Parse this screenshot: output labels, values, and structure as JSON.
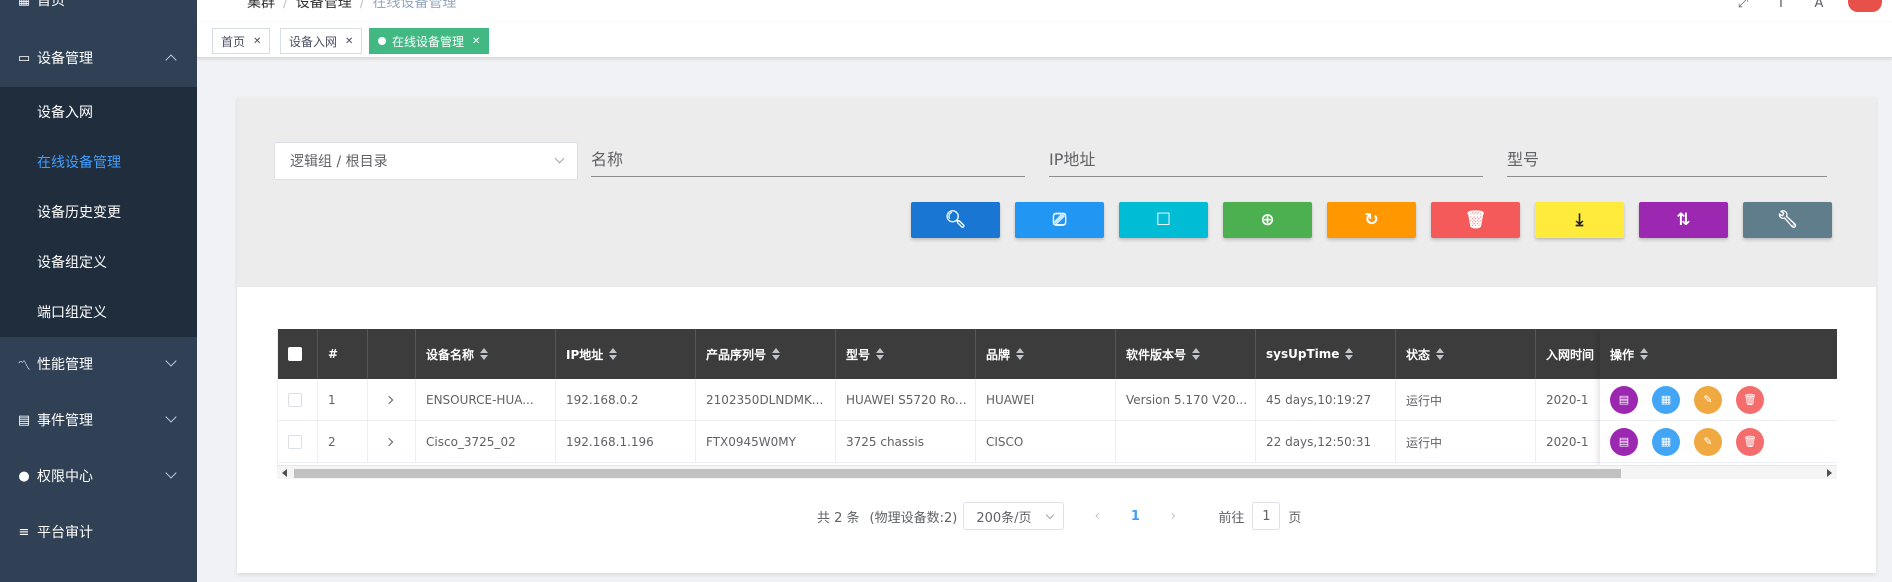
{
  "sidebar": {
    "home": "首页",
    "device_mgmt": "设备管理",
    "sub_items": [
      "设备入网",
      "在线设备管理",
      "设备历史变更",
      "设备组定义",
      "端口组定义"
    ],
    "active_sub": "在线设备管理",
    "perf": "性能管理",
    "events": "事件管理",
    "auth": "权限中心",
    "audit": "平台审计"
  },
  "breadcrumb": [
    "集群",
    "设备管理",
    "在线设备管理"
  ],
  "tags": [
    {
      "label": "首页",
      "active": false
    },
    {
      "label": "设备入网",
      "active": false
    },
    {
      "label": "在线设备管理",
      "active": true
    }
  ],
  "search": {
    "group_select": "逻辑组 / 根目录",
    "name_placeholder": "名称",
    "ip_placeholder": "IP地址",
    "model_placeholder": "型号"
  },
  "toolbar": {
    "colors": [
      "#1976d2",
      "#2196f3",
      "#00bcd4",
      "#4caf50",
      "#ff9800",
      "#f55a5a",
      "#ffeb3b",
      "#9c27b0",
      "#607d8b"
    ],
    "icons": [
      "search-icon",
      "cast-icon",
      "square-icon",
      "zoom-in-icon",
      "refresh-icon",
      "trash-icon",
      "download-icon",
      "swap-icon",
      "wrench-icon"
    ]
  },
  "table": {
    "columns": [
      "",
      "#",
      "",
      "设备名称",
      "IP地址",
      "产品序列号",
      "型号",
      "品牌",
      "软件版本号",
      "sysUpTime",
      "状态",
      "入网时间"
    ],
    "ops_header": "操作",
    "rows": [
      {
        "idx": "1",
        "name": "ENSOURCE-HUA...",
        "ip": "192.168.0.2",
        "serial": "2102350DLNDMK...",
        "model": "HUAWEI S5720 Ro...",
        "brand": "HUAWEI",
        "version": "Version 5.170 V20...",
        "uptime": "45 days,10:19:27",
        "status": "运行中",
        "joined": "2020-1"
      },
      {
        "idx": "2",
        "name": "Cisco_3725_02",
        "ip": "192.168.1.196",
        "serial": "FTX0945W0MY",
        "model": "3725 chassis",
        "brand": "CISCO",
        "version": "",
        "uptime": "22 days,12:50:31",
        "status": "运行中",
        "joined": "2020-1"
      }
    ],
    "op_colors": [
      "#9c27b0",
      "#42a5f5",
      "#f0a940",
      "#f56c6c"
    ]
  },
  "pagination": {
    "total": "共 2 条",
    "physical": "(物理设备数:2)",
    "page_size": "200条/页",
    "current": "1",
    "goto_label": "前往",
    "goto_value": "1",
    "page_unit": "页"
  }
}
